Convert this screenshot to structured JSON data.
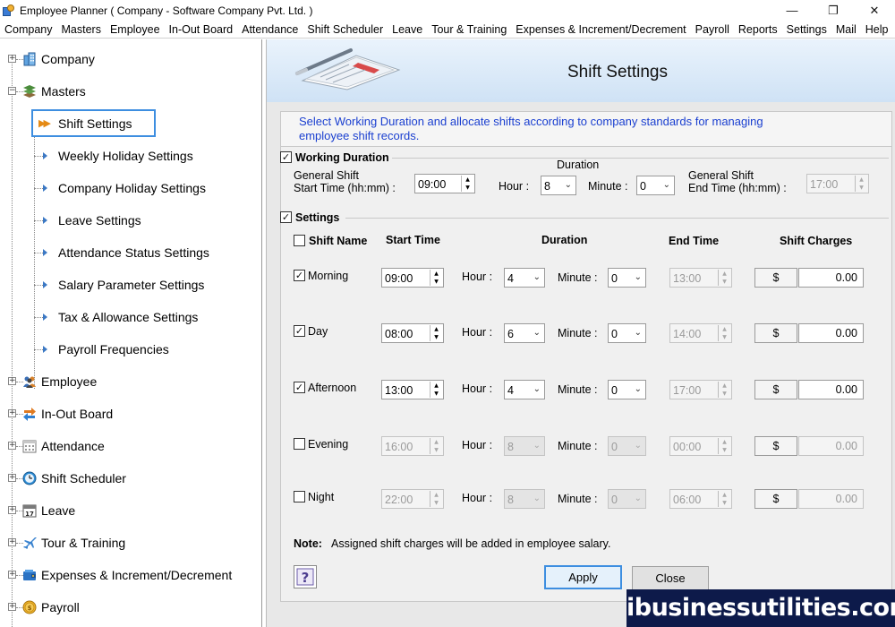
{
  "window": {
    "title": "Employee Planner ( Company - Software Company Pvt. Ltd. )",
    "minimize": "—",
    "maximize": "❐",
    "close": "✕"
  },
  "menu": [
    "Company",
    "Masters",
    "Employee",
    "In-Out Board",
    "Attendance",
    "Shift Scheduler",
    "Leave",
    "Tour & Training",
    "Expenses & Increment/Decrement",
    "Payroll",
    "Reports",
    "Settings",
    "Mail",
    "Help"
  ],
  "tree": {
    "nodes": [
      {
        "label": "Company",
        "icon": "building-icon",
        "expander": "+"
      },
      {
        "label": "Masters",
        "icon": "layers-icon",
        "expander": "−"
      },
      {
        "label": "Employee",
        "icon": "people-icon",
        "expander": "+"
      },
      {
        "label": "In-Out Board",
        "icon": "swap-arrows-icon",
        "expander": "+"
      },
      {
        "label": "Attendance",
        "icon": "calendar-grid-icon",
        "expander": "+"
      },
      {
        "label": "Shift Scheduler",
        "icon": "clock-icon",
        "expander": "+"
      },
      {
        "label": "Leave",
        "icon": "calendar-17-icon",
        "expander": "+"
      },
      {
        "label": "Tour & Training",
        "icon": "airplane-icon",
        "expander": "+"
      },
      {
        "label": "Expenses & Increment/Decrement",
        "icon": "wallet-icon",
        "expander": "+"
      },
      {
        "label": "Payroll",
        "icon": "coin-icon",
        "expander": "+"
      }
    ],
    "masters_children": [
      "Shift Settings",
      "Weekly Holiday Settings",
      "Company Holiday Settings",
      "Leave Settings",
      "Attendance Status Settings",
      "Salary Parameter Settings",
      "Tax & Allowance Settings",
      "Payroll Frequencies"
    ],
    "selected": "Shift Settings",
    "calendar_icon_number": "17"
  },
  "panel": {
    "title": "Shift Settings",
    "intro": "Select Working Duration and allocate shifts according to company standards for managing employee shift records.",
    "working_duration": {
      "label": "Working Duration",
      "checked": true,
      "start_label_1": "General Shift",
      "start_label_2": "Start Time (hh:mm) :",
      "start_value": "09:00",
      "duration_label": "Duration",
      "hour_label": "Hour :",
      "hour_value": "8",
      "minute_label": "Minute :",
      "minute_value": "0",
      "end_label_1": "General Shift",
      "end_label_2": "End Time (hh:mm) :",
      "end_value": "17:00"
    },
    "settings": {
      "label": "Settings",
      "checked": true,
      "columns": {
        "shift_name": "Shift Name",
        "start_time": "Start Time",
        "duration": "Duration",
        "end_time": "End Time",
        "shift_charges": "Shift Charges"
      },
      "hour_label": "Hour :",
      "minute_label": "Minute :",
      "currency": "$",
      "rows": [
        {
          "name": "Morning",
          "checked": true,
          "start": "09:00",
          "hour": "4",
          "minute": "0",
          "end": "13:00",
          "charge": "0.00"
        },
        {
          "name": "Day",
          "checked": true,
          "start": "08:00",
          "hour": "6",
          "minute": "0",
          "end": "14:00",
          "charge": "0.00"
        },
        {
          "name": "Afternoon",
          "checked": true,
          "start": "13:00",
          "hour": "4",
          "minute": "0",
          "end": "17:00",
          "charge": "0.00"
        },
        {
          "name": "Evening",
          "checked": false,
          "start": "16:00",
          "hour": "8",
          "minute": "0",
          "end": "00:00",
          "charge": "0.00"
        },
        {
          "name": "Night",
          "checked": false,
          "start": "22:00",
          "hour": "8",
          "minute": "0",
          "end": "06:00",
          "charge": "0.00"
        }
      ]
    },
    "note_label": "Note:",
    "note_text": "Assigned shift charges will be added in employee salary.",
    "help": "?",
    "apply": "Apply",
    "close": "Close"
  },
  "watermark": "ibusinessutilities.com",
  "colors": {
    "accent": "#3d8ee0",
    "intro_text": "#1a3fd0",
    "banner_top": "#eaf3fc",
    "banner_bottom": "#cfe2f5",
    "watermark_bg": "#0d1a4a"
  }
}
